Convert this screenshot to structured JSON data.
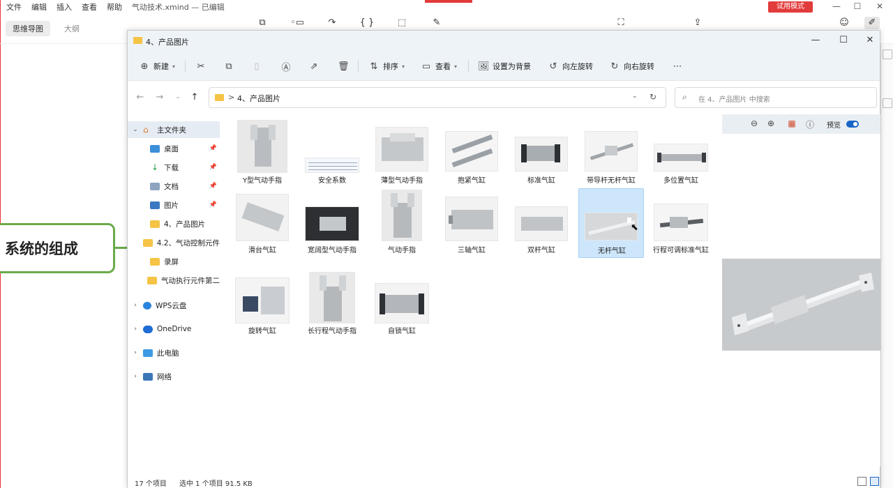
{
  "xmind": {
    "menu": [
      "文件",
      "编辑",
      "插入",
      "查看",
      "帮助"
    ],
    "doc_title": "气动技术.xmind — 已编辑",
    "trial_label": "试用模式",
    "tabs": [
      "思维导图",
      "大纲"
    ],
    "node_text": "系统的组成"
  },
  "explorer": {
    "title": "4、产品图片",
    "commands": {
      "new": "新建",
      "sort": "排序",
      "view": "查看",
      "set_background": "设置为背景",
      "rotate_left": "向左旋转",
      "rotate_right": "向右旋转"
    },
    "address": {
      "separator": ">",
      "path": "4、产品图片"
    },
    "search_placeholder": "在 4、产品图片 中搜索",
    "nav": [
      {
        "label": "主文件夹",
        "icon": "home-icon"
      },
      {
        "label": "桌面",
        "icon": "desktop-icon"
      },
      {
        "label": "下载",
        "icon": "download-icon"
      },
      {
        "label": "文档",
        "icon": "documents-icon"
      },
      {
        "label": "图片",
        "icon": "pictures-icon"
      },
      {
        "label": "4、产品图片",
        "icon": "folder-icon"
      },
      {
        "label": "4.2、气动控制元件",
        "icon": "folder-icon"
      },
      {
        "label": "录屏",
        "icon": "folder-icon"
      },
      {
        "label": "气动执行元件第二",
        "icon": "folder-icon"
      },
      {
        "label": "WPS云盘",
        "icon": "wps-cloud-icon"
      },
      {
        "label": "OneDrive",
        "icon": "onedrive-icon"
      },
      {
        "label": "此电脑",
        "icon": "pc-icon"
      },
      {
        "label": "网络",
        "icon": "network-icon"
      }
    ],
    "files": [
      {
        "name": "Y型气动手指"
      },
      {
        "name": "安全系数"
      },
      {
        "name": "薄型气动手指"
      },
      {
        "name": "抱紧气缸"
      },
      {
        "name": "标准气缸"
      },
      {
        "name": "带导杆无杆气缸"
      },
      {
        "name": "多位置气缸"
      },
      {
        "name": "滑台气缸"
      },
      {
        "name": "宽阔型气动手指"
      },
      {
        "name": "气动手指"
      },
      {
        "name": "三轴气缸"
      },
      {
        "name": "双杆气缸"
      },
      {
        "name": "无杆气缸",
        "selected": true
      },
      {
        "name": "行程可调标准气缸"
      },
      {
        "name": "旋转气缸"
      },
      {
        "name": "长行程气动手指"
      },
      {
        "name": "自锁气缸"
      }
    ],
    "preview_label": "预览",
    "status": {
      "count": "17 个项目",
      "selection": "选中 1 个项目  91.5 KB"
    },
    "colors": {
      "accent": "#1a66c8",
      "selected_bg": "#cde6fb",
      "folder": "#f5c446",
      "node_border": "#6aaa4a"
    }
  }
}
